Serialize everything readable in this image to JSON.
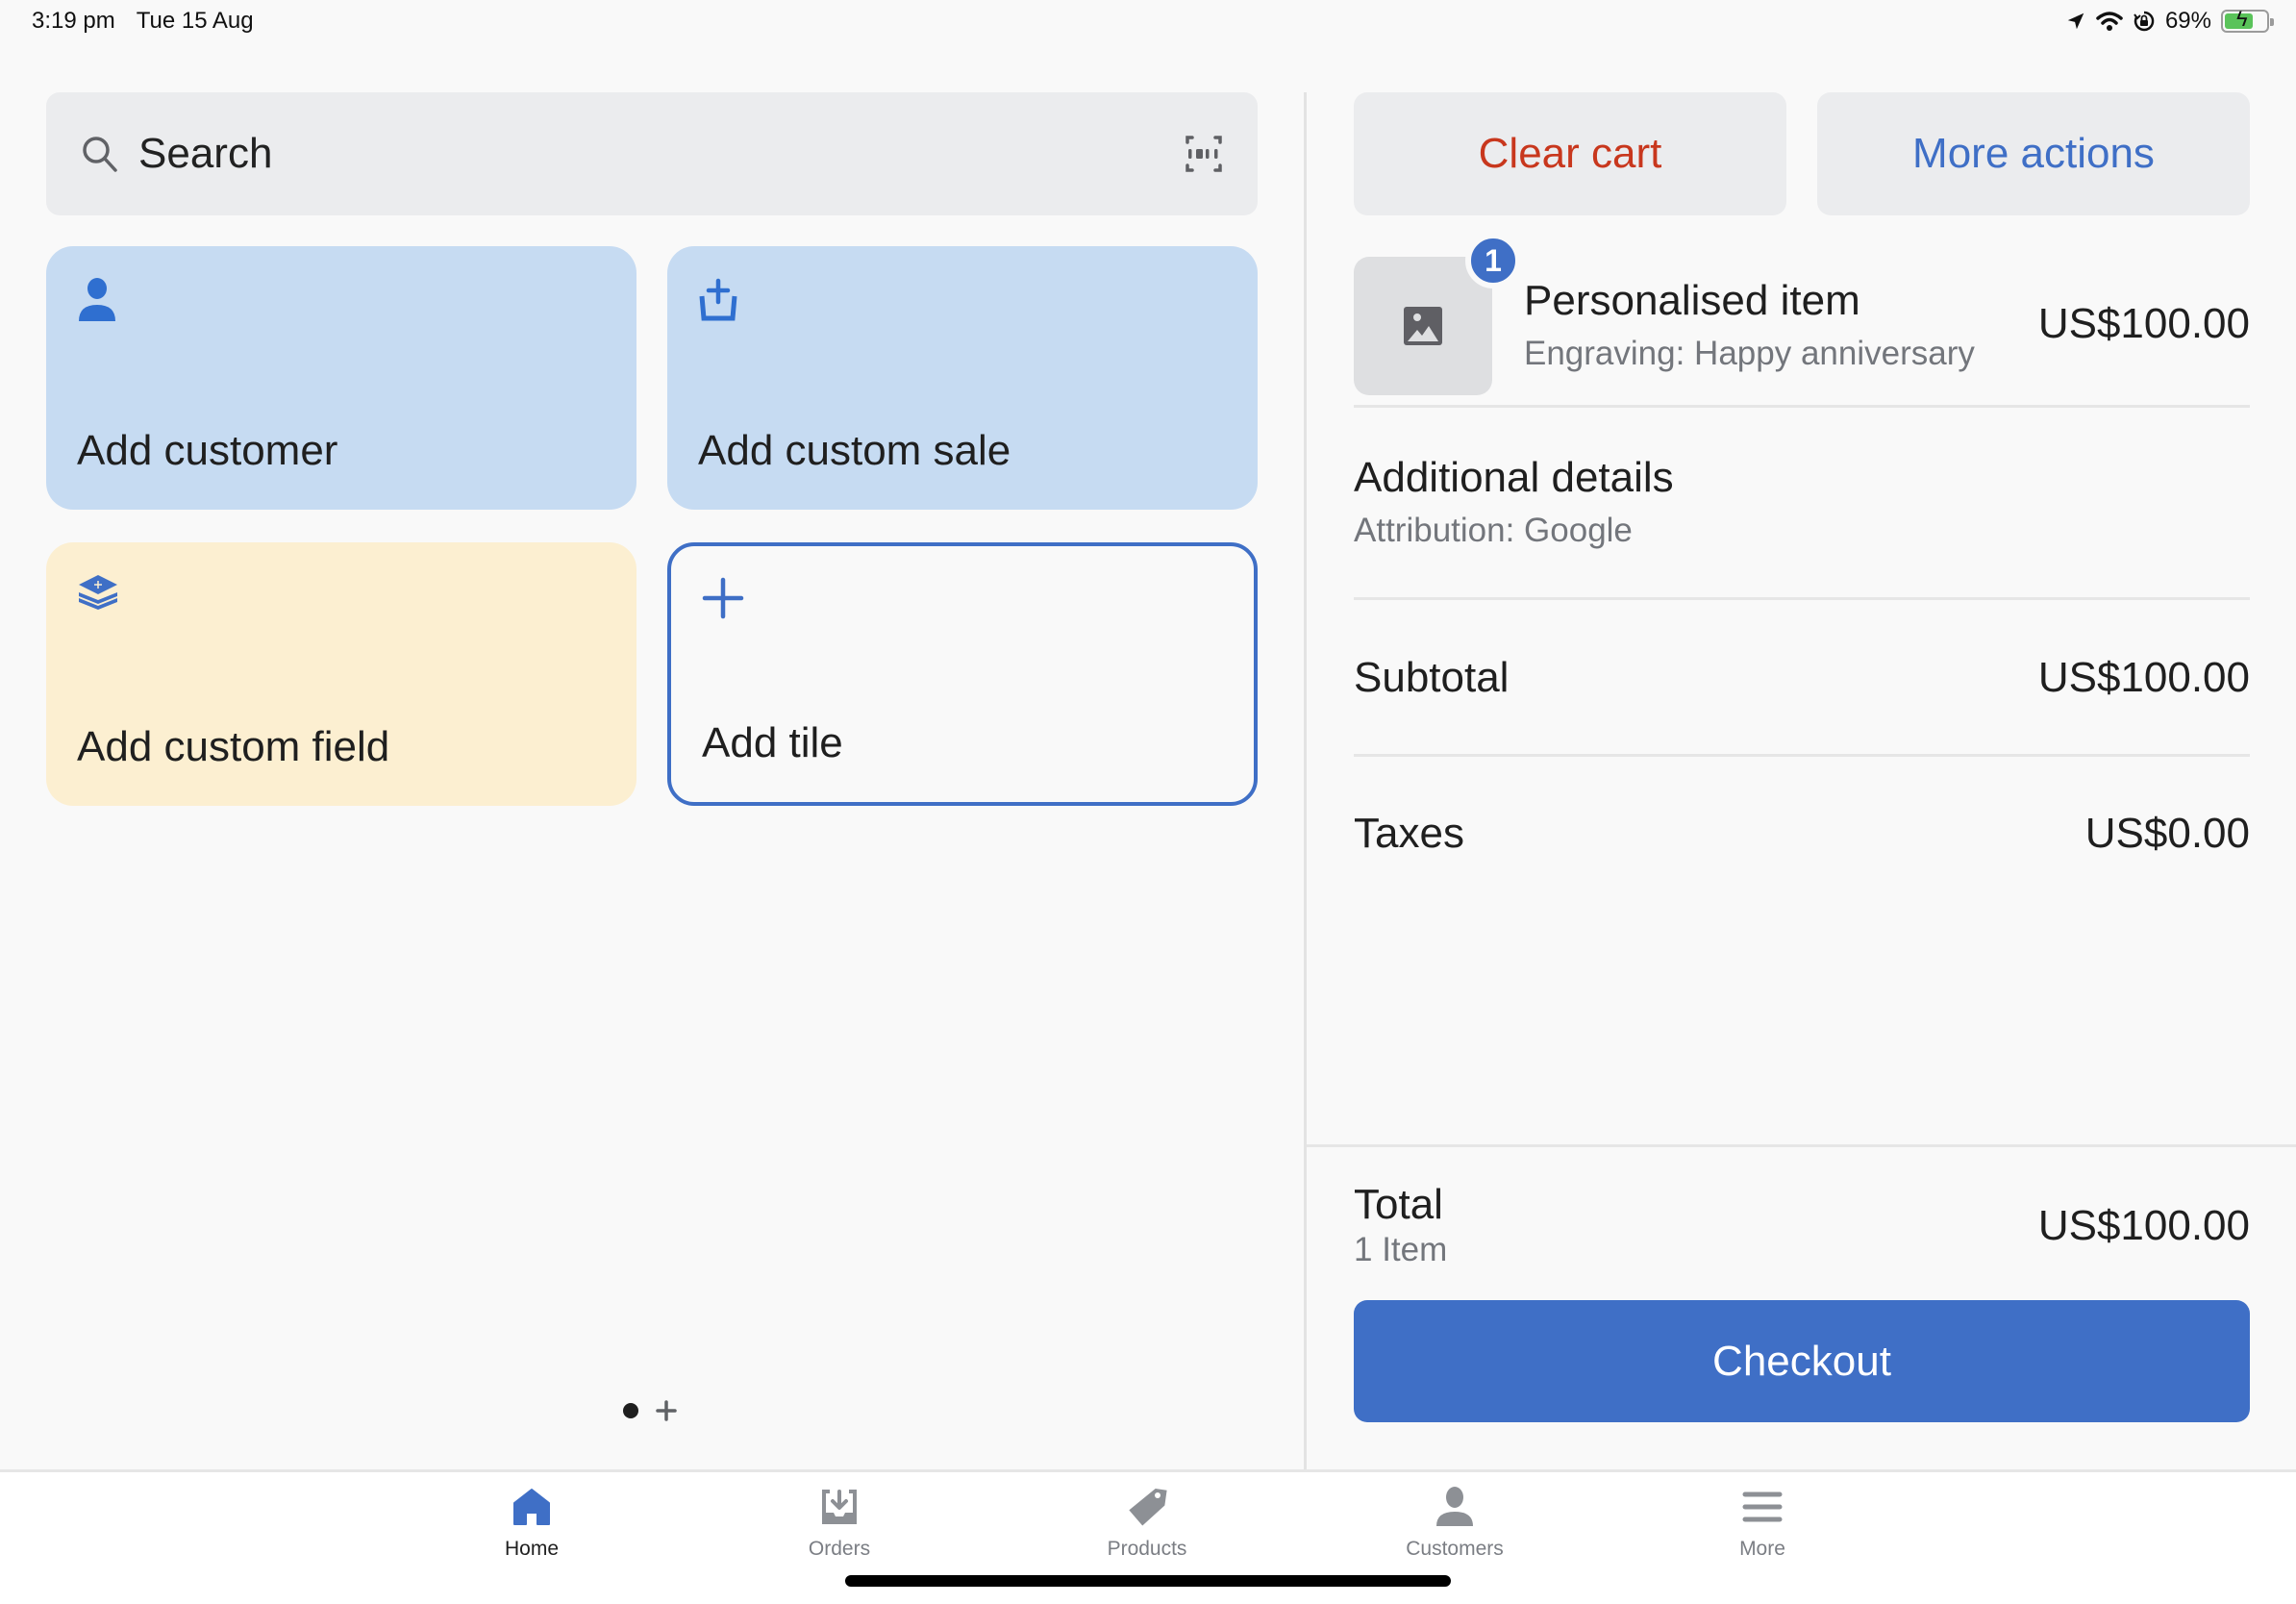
{
  "status_bar": {
    "time": "3:19 pm",
    "date": "Tue 15 Aug",
    "battery_percent": "69%",
    "battery_level": 0.69,
    "charging": true,
    "icons": [
      "location-arrow-icon",
      "wifi-icon",
      "orientation-lock-icon",
      "battery-icon"
    ]
  },
  "search": {
    "placeholder": "Search",
    "icon": "search-icon",
    "scan_icon": "barcode-scan-icon"
  },
  "tiles": [
    {
      "label": "Add customer",
      "icon": "person-icon",
      "color": "#c6dbf2"
    },
    {
      "label": "Add custom sale",
      "icon": "basket-plus-icon",
      "color": "#c6dbf2"
    },
    {
      "label": "Add custom field",
      "icon": "layers-plus-icon",
      "color": "#fcefd1"
    },
    {
      "label": "Add tile",
      "icon": "plus-icon",
      "color": "#f9f9f9"
    }
  ],
  "pager": {
    "pages": 1,
    "current": 1,
    "add_icon": "plus-icon"
  },
  "cart": {
    "clear_label": "Clear cart",
    "more_label": "More actions",
    "items": [
      {
        "quantity": "1",
        "name": "Personalised item",
        "detail": "Engraving: Happy anniversary",
        "price": "US$100.00",
        "thumbnail_icon": "image-placeholder-icon"
      }
    ],
    "additional_details": {
      "title": "Additional details",
      "value": "Attribution: Google"
    },
    "subtotal": {
      "label": "Subtotal",
      "value": "US$100.00"
    },
    "taxes": {
      "label": "Taxes",
      "value": "US$0.00"
    },
    "total": {
      "label": "Total",
      "count": "1 Item",
      "value": "US$100.00"
    },
    "checkout_label": "Checkout"
  },
  "bottom_nav": {
    "items": [
      {
        "label": "Home",
        "icon": "home-icon",
        "active": true
      },
      {
        "label": "Orders",
        "icon": "orders-tray-icon",
        "active": false
      },
      {
        "label": "Products",
        "icon": "tag-icon",
        "active": false
      },
      {
        "label": "Customers",
        "icon": "person-icon",
        "active": false
      },
      {
        "label": "More",
        "icon": "menu-icon",
        "active": false
      }
    ]
  },
  "colors": {
    "accent": "#3f6fc6",
    "danger": "#c8371d",
    "muted_text": "#73767c",
    "nav_inactive": "#8d9095"
  }
}
